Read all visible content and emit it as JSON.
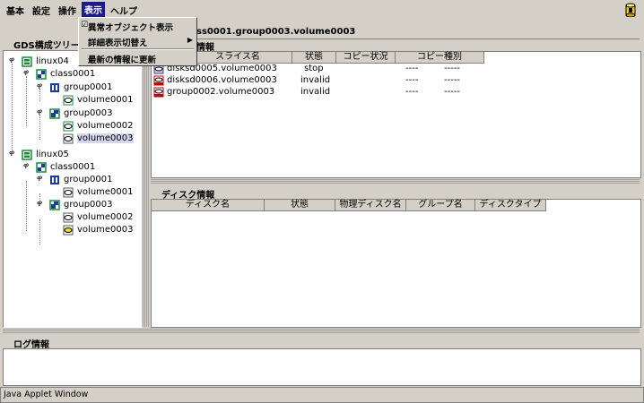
{
  "menubar": {
    "items": [
      "基本",
      "設定",
      "操作",
      "表示",
      "ヘルプ"
    ]
  },
  "dropdown": {
    "items": [
      {
        "label": "異常オブジェクト表示",
        "checked": true
      },
      {
        "label": "詳細表示切替え",
        "submenu": true
      },
      {
        "label": "最新の情報に更新"
      }
    ]
  },
  "tree": {
    "header": "GDS構成ツリー",
    "nodes": [
      {
        "label": "linux04"
      },
      {
        "label": "class0001"
      },
      {
        "label": "group0001"
      },
      {
        "label": "volume0001"
      },
      {
        "label": "group0003"
      },
      {
        "label": "volume0002"
      },
      {
        "label": "volume0003"
      },
      {
        "label": "linux05"
      },
      {
        "label": "class0001"
      },
      {
        "label": "group0001"
      },
      {
        "label": "volume0001"
      },
      {
        "label": "group0003"
      },
      {
        "label": "volume0002"
      },
      {
        "label": "volume0003"
      }
    ]
  },
  "main": {
    "title": "ss0001.group0003.volume0003",
    "slice_panel": {
      "header": "情報",
      "columns": [
        "スライス名",
        "状態",
        "コピー状況",
        "コピー種別"
      ],
      "rows": [
        [
          "disksd0005.volume0003",
          "stop",
          "----",
          "-----"
        ],
        [
          "disksd0006.volume0003",
          "invalid",
          "----",
          "-----"
        ],
        [
          "group0002.volume0003",
          "invalid",
          "----",
          "-----"
        ]
      ]
    },
    "disk_panel": {
      "header": "ディスク情報",
      "columns": [
        "ディスク名",
        "状態",
        "物理ディスク名",
        "グループ名",
        "ディスクタイプ"
      ]
    }
  },
  "log": {
    "header": "ログ情報"
  },
  "status_bar": "Java Applet Window",
  "colors": {
    "menu_highlight": "#1b1b8c",
    "selected_row": "#d6d6ee",
    "icon_red": "#c00000",
    "icon_green": "#1a8a3a"
  }
}
